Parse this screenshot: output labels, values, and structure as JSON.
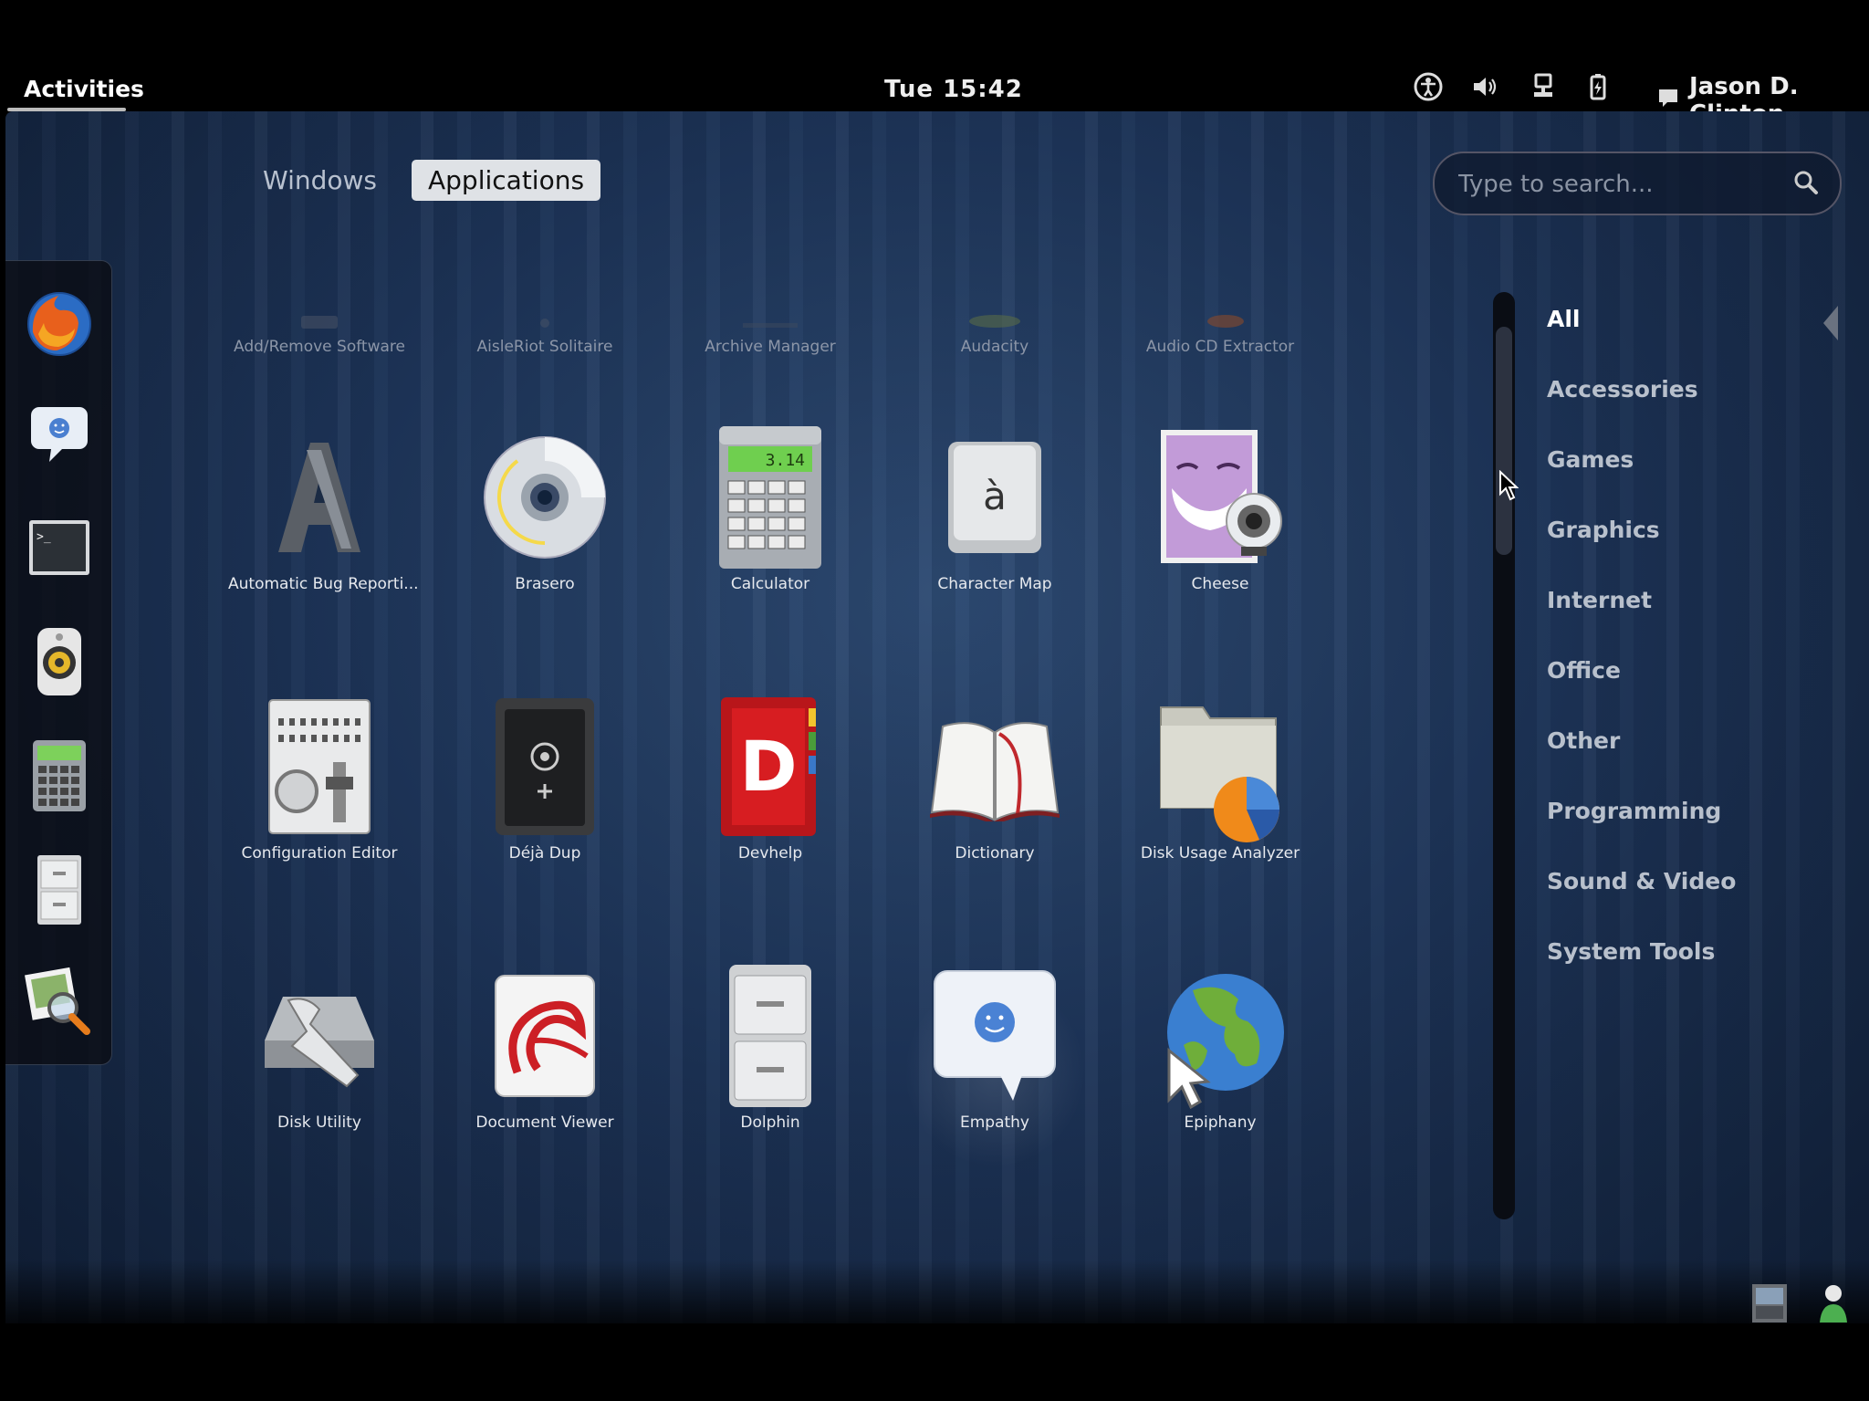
{
  "topbar": {
    "activities_label": "Activities",
    "clock": "Tue 15:42",
    "user_name": "Jason D. Clinton"
  },
  "view_tabs": {
    "windows_label": "Windows",
    "applications_label": "Applications"
  },
  "search": {
    "placeholder": "Type to search..."
  },
  "apps": [
    {
      "label": "Add/Remove Software"
    },
    {
      "label": "AisleRiot Solitaire"
    },
    {
      "label": "Archive Manager"
    },
    {
      "label": "Audacity"
    },
    {
      "label": "Audio CD Extractor"
    },
    {
      "label": "Automatic Bug Reporti..."
    },
    {
      "label": "Brasero"
    },
    {
      "label": "Calculator"
    },
    {
      "label": "Character Map"
    },
    {
      "label": "Cheese"
    },
    {
      "label": "Configuration Editor"
    },
    {
      "label": "Déjà Dup"
    },
    {
      "label": "Devhelp"
    },
    {
      "label": "Dictionary"
    },
    {
      "label": "Disk Usage Analyzer"
    },
    {
      "label": "Disk Utility"
    },
    {
      "label": "Document Viewer"
    },
    {
      "label": "Dolphin"
    },
    {
      "label": "Empathy"
    },
    {
      "label": "Epiphany"
    }
  ],
  "calculator_display": "3.14",
  "charmap_glyph": "à",
  "devhelp_glyph": "D",
  "categories": [
    {
      "label": "All"
    },
    {
      "label": "Accessories"
    },
    {
      "label": "Games"
    },
    {
      "label": "Graphics"
    },
    {
      "label": "Internet"
    },
    {
      "label": "Office"
    },
    {
      "label": "Other"
    },
    {
      "label": "Programming"
    },
    {
      "label": "Sound & Video"
    },
    {
      "label": "System Tools"
    }
  ],
  "active_category": "All",
  "active_view": "Applications",
  "dash_icons": [
    "firefox-icon",
    "empathy-icon",
    "terminal-icon",
    "rhythmbox-icon",
    "calculator-icon",
    "file-cabinet-icon",
    "image-viewer-icon"
  ],
  "colors": {
    "background_top": "#2d4a72",
    "background_edge": "#0f1d34",
    "active_tab_bg": "#dfe2e6",
    "topbar": "#000000"
  }
}
